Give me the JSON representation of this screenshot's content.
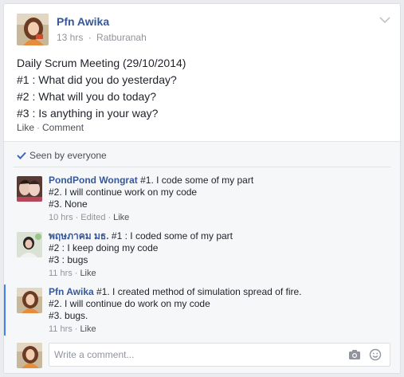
{
  "post": {
    "author": "Pfn Awika",
    "time": "13 hrs",
    "location": "Ratburanah",
    "meta_sep": "·",
    "lines": [
      "Daily Scrum Meeting (29/10/2014)",
      "#1 : What did you do yesterday?",
      "#2 : What will you do today?",
      "#3 : Is anything in your way?"
    ],
    "actions": {
      "like": "Like",
      "sep": "·",
      "comment": "Comment"
    }
  },
  "seen": {
    "label": "Seen by everyone"
  },
  "comments": [
    {
      "name": "PondPond Wongrat",
      "lines": [
        "#1. I code some of my part",
        "#2. I will continue work on my code",
        "#3. None"
      ],
      "time": "10 hrs",
      "edited": "Edited",
      "like": "Like"
    },
    {
      "name": "พฤษภาคม มธ.",
      "lines": [
        "#1 : I coded some of my part",
        "#2 : I keep doing my code",
        "#3 : bugs"
      ],
      "time": "11 hrs",
      "like": "Like"
    },
    {
      "name": "Pfn Awika",
      "lines": [
        "#1. I created method of simulation spread of fire.",
        "#2. I will continue do work on my code",
        "#3. bugs."
      ],
      "time": "11 hrs",
      "like": "Like"
    }
  ],
  "composer": {
    "placeholder": "Write a comment..."
  },
  "colors": {
    "link": "#365899",
    "accent": "#4080ff",
    "muted": "#90949c"
  }
}
